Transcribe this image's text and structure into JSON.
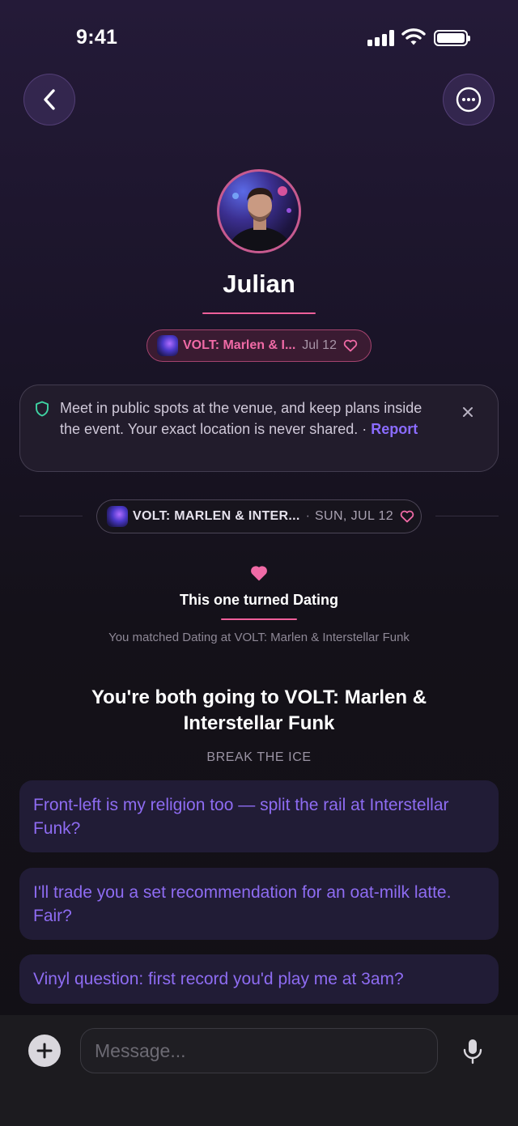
{
  "status_bar": {
    "time": "9:41"
  },
  "header": {
    "back_icon": "chevron-left-icon",
    "more_icon": "ellipsis-circle-icon"
  },
  "profile": {
    "name": "Julian"
  },
  "event_chip": {
    "title": "VOLT: Marlen & I...",
    "date": "Jul 12",
    "heart_icon": "heart-outline-icon"
  },
  "safety": {
    "text": "Meet in public spots at the venue, and keep plans inside the event. Your exact location is never shared. · ",
    "report_label": "Report",
    "shield_icon": "shield-icon",
    "close_icon": "close-icon"
  },
  "event_pill": {
    "title": "VOLT: MARLEN & INTER...",
    "separator": "·",
    "date": "SUN, JUL 12"
  },
  "match": {
    "title": "This one turned Dating",
    "subtitle": "You matched Dating at VOLT: Marlen & Interstellar Funk"
  },
  "icebreakers": {
    "heading": "You're both going to VOLT: Marlen & Interstellar Funk",
    "label": "BREAK THE ICE",
    "prompts": [
      "Front-left is my religion too — split the rail at Interstellar Funk?",
      "I'll trade you a set recommendation for an oat-milk latte. Fair?",
      "Vinyl question: first record you'd play me at 3am?"
    ]
  },
  "composer": {
    "placeholder": "Message...",
    "plus_icon": "plus-icon",
    "mic_icon": "microphone-icon"
  },
  "colors": {
    "accent_pink": "#ee5f9a",
    "accent_purple": "#8b6cff",
    "prompt_text": "#8e6cf2",
    "background": "#141119"
  }
}
